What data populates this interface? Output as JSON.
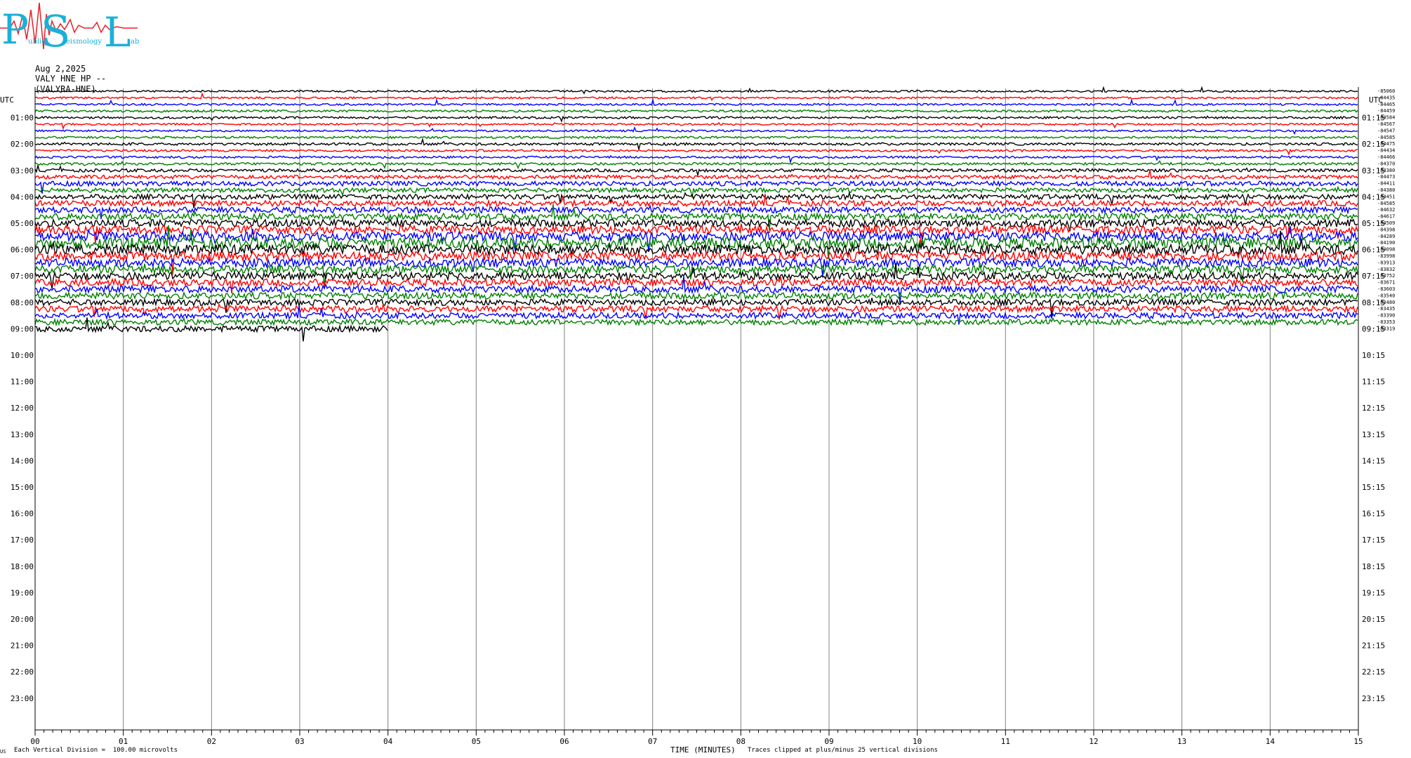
{
  "logo": {
    "letters": [
      "P",
      "S",
      "L"
    ],
    "small_text": [
      "ublic",
      "eismology",
      "ab"
    ],
    "colors": {
      "letters": "#1ab0d8",
      "wave": "#e8202a"
    }
  },
  "header": {
    "date": "Aug 2,2025",
    "channel": "VALY HNE HP --",
    "name": "(VALYRA-HNE)"
  },
  "footer": {
    "left_mark": "US",
    "division": "Each Vertical Division =  100.00 microvolts",
    "clip": "Traces clipped at plus/minus 25 vertical divisions"
  },
  "chart_data": {
    "type": "line",
    "title": "",
    "xlabel": "TIME (MINUTES)",
    "ylabel": "",
    "xlim": [
      0,
      15
    ],
    "x_ticks": [
      "00",
      "01",
      "02",
      "03",
      "04",
      "05",
      "06",
      "07",
      "08",
      "09",
      "10",
      "11",
      "12",
      "13",
      "14",
      "15"
    ],
    "left_axis_label": "UTC",
    "right_axis_label": "UTC",
    "left_hour_labels": [
      "01:00",
      "02:00",
      "03:00",
      "04:00",
      "05:00",
      "06:00",
      "07:00",
      "08:00",
      "09:00",
      "10:00",
      "11:00",
      "12:00",
      "13:00",
      "14:00",
      "15:00",
      "16:00",
      "17:00",
      "18:00",
      "19:00",
      "20:00",
      "21:00",
      "22:00",
      "23:00"
    ],
    "right_hour_labels": [
      "01:15",
      "02:15",
      "03:15",
      "04:15",
      "05:15",
      "06:15",
      "07:15",
      "08:15",
      "09:15",
      "10:15",
      "11:15",
      "12:15",
      "13:15",
      "14:15",
      "15:15",
      "16:15",
      "17:15",
      "18:15",
      "19:15",
      "20:15",
      "21:15",
      "22:15",
      "23:15"
    ],
    "trace_colors": [
      "#000000",
      "#ff0000",
      "#0000ff",
      "#008000"
    ],
    "trace_interval_minutes": 15,
    "traces_recorded": 37,
    "last_trace_end_minute": 4,
    "trace_offsets": [
      "-85060",
      "-84435",
      "-84465",
      "-84459",
      "-84584",
      "-84567",
      "-84547",
      "-84585",
      "-84475",
      "-84434",
      "-84466",
      "-84370",
      "-84380",
      "-84473",
      "-84411",
      "-84380",
      "-84451",
      "-84585",
      "-84632",
      "-84617",
      "-84509",
      "-84398",
      "-84289",
      "-84190",
      "-84098",
      "-83998",
      "-83913",
      "-83832",
      "-83752",
      "-83671",
      "-83603",
      "-83540",
      "-83480",
      "-83435",
      "-83390",
      "-83353",
      "-83319"
    ],
    "trace_amplitude_divisions": [
      0.6,
      0.6,
      0.6,
      0.7,
      0.7,
      0.6,
      0.6,
      0.7,
      0.8,
      0.7,
      0.7,
      0.8,
      1.0,
      1.2,
      1.5,
      1.4,
      1.6,
      1.8,
      1.9,
      2.1,
      2.4,
      2.6,
      2.9,
      3.4,
      3.2,
      2.8,
      2.7,
      2.5,
      2.4,
      2.3,
      2.2,
      2.1,
      2.0,
      2.0,
      1.9,
      1.8,
      1.9
    ]
  }
}
